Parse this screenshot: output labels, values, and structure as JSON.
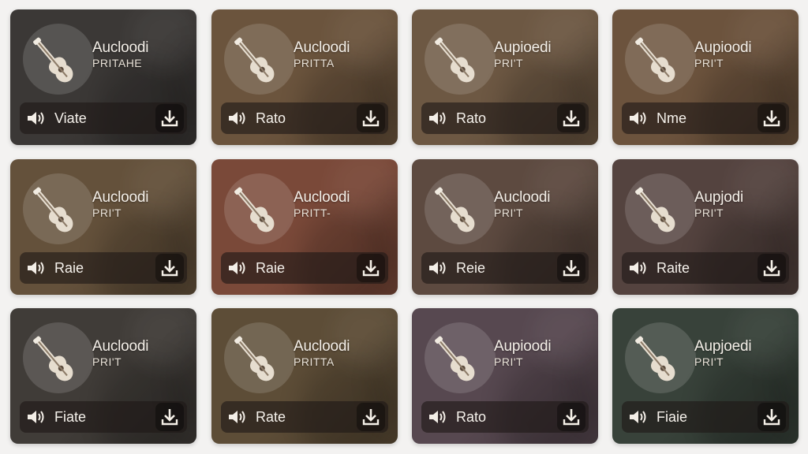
{
  "cards": [
    {
      "title": "Aucloodi",
      "subtitle": "PRITAHE",
      "label": "Viate",
      "color": "#3b3836"
    },
    {
      "title": "Aucloodi",
      "subtitle": "PRITTA",
      "label": "Rato",
      "color": "#6b543d"
    },
    {
      "title": "Aupioedi",
      "subtitle": "PRI'T",
      "label": "Rato",
      "color": "#6d5843"
    },
    {
      "title": "Aupioodi",
      "subtitle": "PRI'T",
      "label": "Nme",
      "color": "#6c533d"
    },
    {
      "title": "Aucloodi",
      "subtitle": "PRI'T",
      "label": "Raie",
      "color": "#64513b"
    },
    {
      "title": "Aucloodi",
      "subtitle": "PRITT-",
      "label": "Raie",
      "color": "#7a4939"
    },
    {
      "title": "Aucloodi",
      "subtitle": "PRI'T",
      "label": "Reie",
      "color": "#5d4a40"
    },
    {
      "title": "Aupjodi",
      "subtitle": "PRI'T",
      "label": "Raite",
      "color": "#54433f"
    },
    {
      "title": "Aucloodi",
      "subtitle": "PRI'T",
      "label": "Fiate",
      "color": "#403c38"
    },
    {
      "title": "Aucloodi",
      "subtitle": "PRITTA",
      "label": "Rate",
      "color": "#5d4d37"
    },
    {
      "title": "Aupioodi",
      "subtitle": "PRI'T",
      "label": "Rato",
      "color": "#574850"
    },
    {
      "title": "Aupjoedi",
      "subtitle": "PRI'T",
      "label": "Fiaie",
      "color": "#38423a"
    }
  ]
}
